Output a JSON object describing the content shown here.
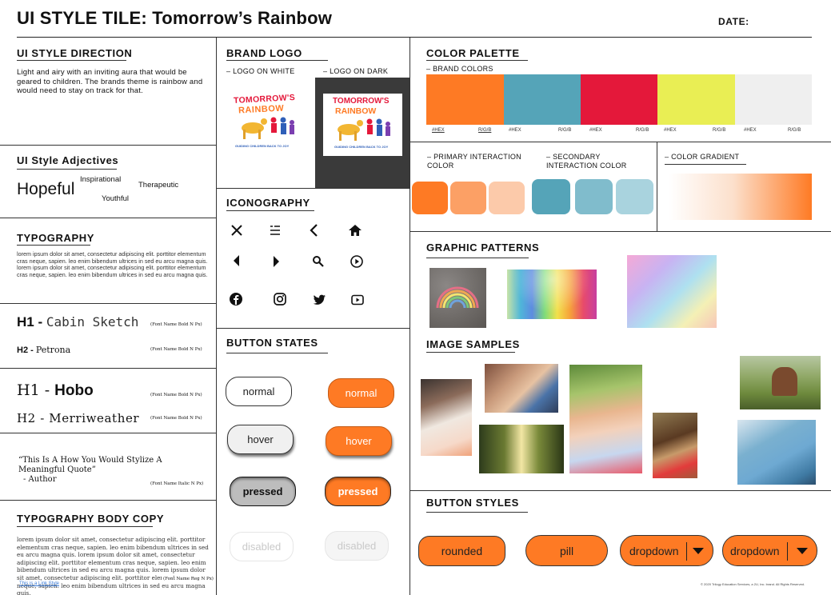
{
  "header": {
    "title": "UI STYLE TILE: Tomorrow’s Rainbow",
    "date_label": "DATE:"
  },
  "direction": {
    "title": "UI STYLE DIRECTION",
    "text": "Light and airy with an inviting aura that would be geared to children. The brands theme is rainbow and would need to stay on track for that."
  },
  "adjectives": {
    "title": "UI Style Adjectives",
    "words": [
      "Hopeful",
      "Inspirational",
      "Therapeutic",
      "Youthful"
    ]
  },
  "typography": {
    "title": "TYPOGRAPHY",
    "lorem": "lorem ipsum dolor sit amet, consectetur adipiscing elit. porttitor elementum cras neque, sapien. leo enim bibendum ultrices in sed eu arcu magna quis. lorem ipsum dolor sit amet, consectetur adipiscing elit. porttitor elementum cras neque, sapien. leo enim bibendum ultrices in sed eu arcu magna quis.",
    "h1a_label": "H1 - ",
    "h1a_font": "Cabin Sketch",
    "h1a_note": "(Font Name Bold N Px)",
    "h2a_label": "H2 - ",
    "h2a_font": "Petrona",
    "h2a_note": "(Font Name Bold N Px)",
    "h1b_label": "H1 - ",
    "h1b_font": "Hobo",
    "h1b_note": "(Font Name Bold N Px)",
    "h2b_label": "H2 - Merriweather",
    "h2b_note": "(Font Name Bold N Px)",
    "quote": "“This Is A How You Would Stylize A Meaningful Quote”",
    "quote_author": "- Author",
    "quote_note": "(Font Name Italic N Px)"
  },
  "body_copy": {
    "title": "TYPOGRAPHY BODY COPY",
    "text": "lorem ipsum dolor sit amet, consectetur adipiscing elit. porttitor elementum cras neque, sapien. leo enim bibendum ultrices in sed eu arcu magna quis. lorem ipsum dolor sit amet, consectetur adipiscing elit. porttitor elementum cras neque, sapien. leo enim bibendum ultrices in sed eu arcu magna quis. lorem ipsum dolor sit amet, consectetur adipiscing elit. porttitor elementum cras neque, sapien. leo enim bibendum ultrices in sed eu arcu magna quis.",
    "note": "(Font Name  Reg N Px)",
    "link": "This is a Link Style"
  },
  "logo": {
    "title": "BRAND LOGO",
    "on_white": "– LOGO ON WHITE",
    "on_dark": "– LOGO ON DARK",
    "name_line1": "TOMORROW'S",
    "name_line2": "RAINBOW",
    "tagline": "GUIDING CHILDREN BACK TO JOY"
  },
  "iconography": {
    "title": "ICONOGRAPHY",
    "icons": [
      "close-icon",
      "menu-icon",
      "chevron-left-icon",
      "home-icon",
      "caret-left-icon",
      "caret-right-icon",
      "search-icon",
      "play-circle-icon",
      "facebook-icon",
      "instagram-icon",
      "twitter-icon",
      "youtube-icon"
    ]
  },
  "button_states": {
    "title": "BUTTON STATES",
    "normal": "normal",
    "hover": "hover",
    "pressed": "pressed",
    "disabled": "disabled"
  },
  "palette": {
    "title": "COLOR PALETTE",
    "brand_label": "– BRAND COLORS",
    "swatches": [
      {
        "color": "#fe7a24",
        "hex": "#HEX",
        "rgb": "R/G/B"
      },
      {
        "color": "#55a4b8",
        "hex": "#HEX",
        "rgb": "R/G/B"
      },
      {
        "color": "#e4183a",
        "hex": "#HEX",
        "rgb": "R/G/B"
      },
      {
        "color": "#e9ee54",
        "hex": "#HEX",
        "rgb": "R/G/B"
      },
      {
        "color": "#efefef",
        "hex": "#HEX",
        "rgb": "R/G/B"
      }
    ],
    "primary_label": "– PRIMARY INTERACTION COLOR",
    "primary_colors": [
      "#fe7a24",
      "#fca065",
      "#fccaaa"
    ],
    "secondary_label": "– SECONDARY INTERACTION COLOR",
    "secondary_colors": [
      "#55a4b8",
      "#80bccc",
      "#a9d3de"
    ],
    "gradient_label": "– COLOR GRADIENT",
    "gradient": [
      "#ffffff",
      "#fe7a24"
    ]
  },
  "patterns": {
    "title": "GRAPHIC PATTERNS"
  },
  "images": {
    "title": "IMAGE SAMPLES"
  },
  "button_styles": {
    "title": "BUTTON STYLES",
    "rounded": "rounded",
    "pill": "pill",
    "dropdown1": "dropdown",
    "dropdown2": "dropdown"
  },
  "footer": {
    "copyright": "© 2020 Trilogy Education Services, a 2U, Inc. brand. All Rights Reserved."
  }
}
